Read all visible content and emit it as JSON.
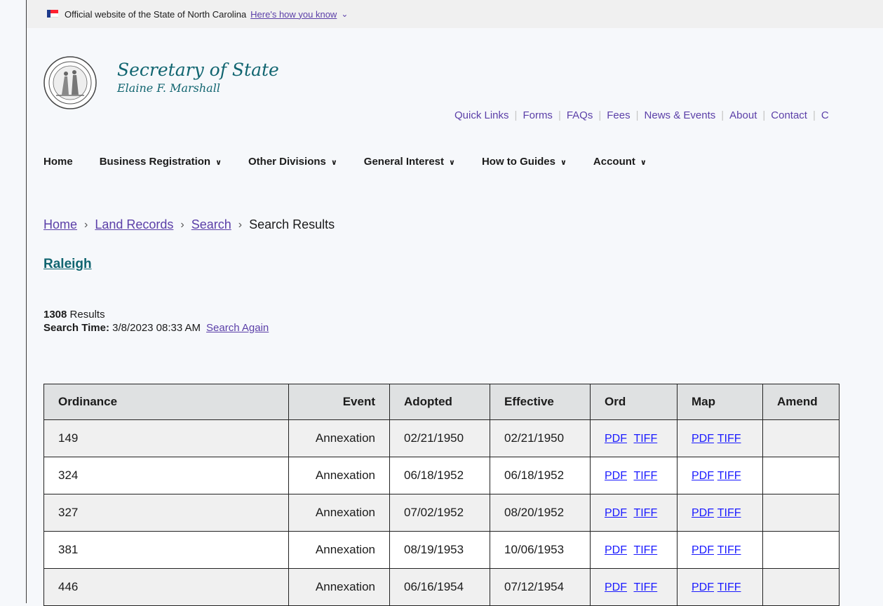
{
  "banner": {
    "official_text": "Official website of the State of North Carolina",
    "how_link": "Here's how you know",
    "chevron": "⌄"
  },
  "brand": {
    "title": "Secretary of State",
    "subtitle": "Elaine F. Marshall"
  },
  "quick_links": [
    "Quick Links",
    "Forms",
    "FAQs",
    "Fees",
    "News & Events",
    "About",
    "Contact",
    "C"
  ],
  "nav": [
    {
      "label": "Home",
      "dropdown": false
    },
    {
      "label": "Business Registration",
      "dropdown": true
    },
    {
      "label": "Other Divisions",
      "dropdown": true
    },
    {
      "label": "General Interest",
      "dropdown": true
    },
    {
      "label": "How to Guides",
      "dropdown": true
    },
    {
      "label": "Account",
      "dropdown": true
    }
  ],
  "breadcrumb": {
    "home": "Home",
    "land": "Land Records",
    "search": "Search",
    "current": "Search Results"
  },
  "place": "Raleigh",
  "results": {
    "count": "1308",
    "count_label": "Results",
    "time_label": "Search Time:",
    "time_value": "3/8/2023 08:33 AM",
    "again": "Search Again"
  },
  "table": {
    "headers": [
      "Ordinance",
      "Event",
      "Adopted",
      "Effective",
      "Ord",
      "Map",
      "Amend"
    ],
    "link_pdf": "PDF",
    "link_tiff": "TIFF",
    "rows": [
      {
        "ordinance": "149",
        "event": "Annexation",
        "adopted": "02/21/1950",
        "effective": "02/21/1950"
      },
      {
        "ordinance": "324",
        "event": "Annexation",
        "adopted": "06/18/1952",
        "effective": "06/18/1952"
      },
      {
        "ordinance": "327",
        "event": "Annexation",
        "adopted": "07/02/1952",
        "effective": "08/20/1952"
      },
      {
        "ordinance": "381",
        "event": "Annexation",
        "adopted": "08/19/1953",
        "effective": "10/06/1953"
      },
      {
        "ordinance": "446",
        "event": "Annexation",
        "adopted": "06/16/1954",
        "effective": "07/12/1954"
      }
    ]
  },
  "colors": {
    "brand_teal": "#116570",
    "link_purple": "#5b3fa8",
    "table_link_blue": "#1a1aff"
  }
}
